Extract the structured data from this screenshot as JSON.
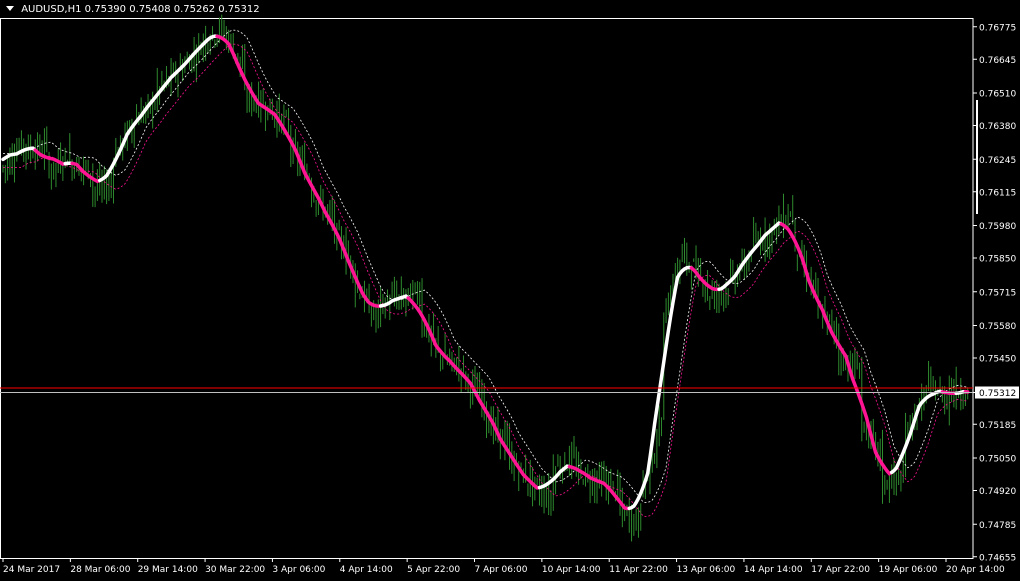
{
  "header": {
    "symbol": "AUDUSD,H1",
    "ohlc": "0.75390 0.75408 0.75262 0.75312"
  },
  "colors": {
    "background": "#000000",
    "candles": "#2E8B2E",
    "axis": "#FFFFFF",
    "ma_up": "#FFFFFF",
    "ma_down": "#FF1493",
    "band_upper": "#FFFFFF",
    "band_lower": "#FF1493",
    "bid_line": "#FF0000",
    "price_line": "#C0C0C0"
  },
  "chart_data": {
    "type": "candlestick",
    "symbol": "AUDUSD",
    "timeframe": "H1",
    "ylim": [
      0.7465,
      0.7681
    ],
    "y_ticks": [
      "0.76775",
      "0.76645",
      "0.76510",
      "0.76380",
      "0.76245",
      "0.76115",
      "0.75980",
      "0.75850",
      "0.75715",
      "0.75580",
      "0.75450",
      "0.75312",
      "0.75185",
      "0.75050",
      "0.74920",
      "0.74785",
      "0.74655"
    ],
    "x_ticks": [
      "24 Mar 2017",
      "28 Mar 06:00",
      "29 Mar 14:00",
      "30 Mar 22:00",
      "3 Apr 06:00",
      "4 Apr 14:00",
      "5 Apr 22:00",
      "7 Apr 06:00",
      "10 Apr 14:00",
      "11 Apr 22:00",
      "13 Apr 06:00",
      "14 Apr 14:00",
      "17 Apr 22:00",
      "19 Apr 06:00",
      "20 Apr 14:00"
    ],
    "current_price": 0.75312,
    "bid_line": 0.7533,
    "close_path": [
      [
        0.7621,
        0.7632
      ],
      [
        0.7628,
        0.7629
      ],
      [
        0.7618,
        0.7627
      ],
      [
        0.7623,
        0.762
      ],
      [
        0.7612,
        0.7615
      ],
      [
        0.7625,
        0.764
      ],
      [
        0.764,
        0.7648
      ],
      [
        0.7652,
        0.766
      ],
      [
        0.766,
        0.7669
      ],
      [
        0.7671,
        0.7677
      ],
      [
        0.7676,
        0.766
      ],
      [
        0.765,
        0.7645
      ],
      [
        0.7645,
        0.7638
      ],
      [
        0.763,
        0.7617
      ],
      [
        0.7612,
        0.76
      ],
      [
        0.7598,
        0.758
      ],
      [
        0.7575,
        0.756
      ],
      [
        0.7565,
        0.757
      ],
      [
        0.7568,
        0.7572
      ],
      [
        0.756,
        0.7545
      ],
      [
        0.7545,
        0.754
      ],
      [
        0.7536,
        0.7528
      ],
      [
        0.752,
        0.751
      ],
      [
        0.7505,
        0.7495
      ],
      [
        0.7495,
        0.7488
      ],
      [
        0.75,
        0.7505
      ],
      [
        0.75,
        0.7495
      ],
      [
        0.7497,
        0.7492
      ],
      [
        0.7485,
        0.7478
      ],
      [
        0.749,
        0.752
      ],
      [
        0.756,
        0.759
      ],
      [
        0.7585,
        0.7575
      ],
      [
        0.757,
        0.7572
      ],
      [
        0.7575,
        0.7585
      ],
      [
        0.759,
        0.7595
      ],
      [
        0.7598,
        0.7604
      ],
      [
        0.759,
        0.757
      ],
      [
        0.7565,
        0.7555
      ],
      [
        0.7545,
        0.754
      ],
      [
        0.752,
        0.7505
      ],
      [
        0.7495,
        0.7497
      ],
      [
        0.7515,
        0.753
      ],
      [
        0.7535,
        0.7528
      ],
      [
        0.7532,
        0.7531
      ]
    ],
    "ma_series": [
      {
        "role": "rising",
        "color": "#FFFFFF"
      },
      {
        "role": "falling",
        "color": "#FF1493"
      }
    ]
  }
}
